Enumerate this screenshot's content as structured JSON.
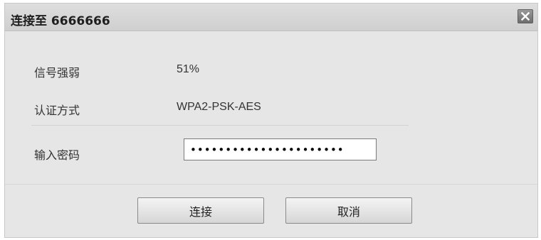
{
  "dialog": {
    "title": "连接至 6666666",
    "close_icon": "close-icon"
  },
  "info": {
    "signal_label": "信号强弱",
    "signal_value": "51%",
    "auth_label": "认证方式",
    "auth_value": "WPA2-PSK-AES"
  },
  "password": {
    "label": "输入密码",
    "value": "••••••••••••••••••••••"
  },
  "buttons": {
    "connect": "连接",
    "cancel": "取消"
  }
}
